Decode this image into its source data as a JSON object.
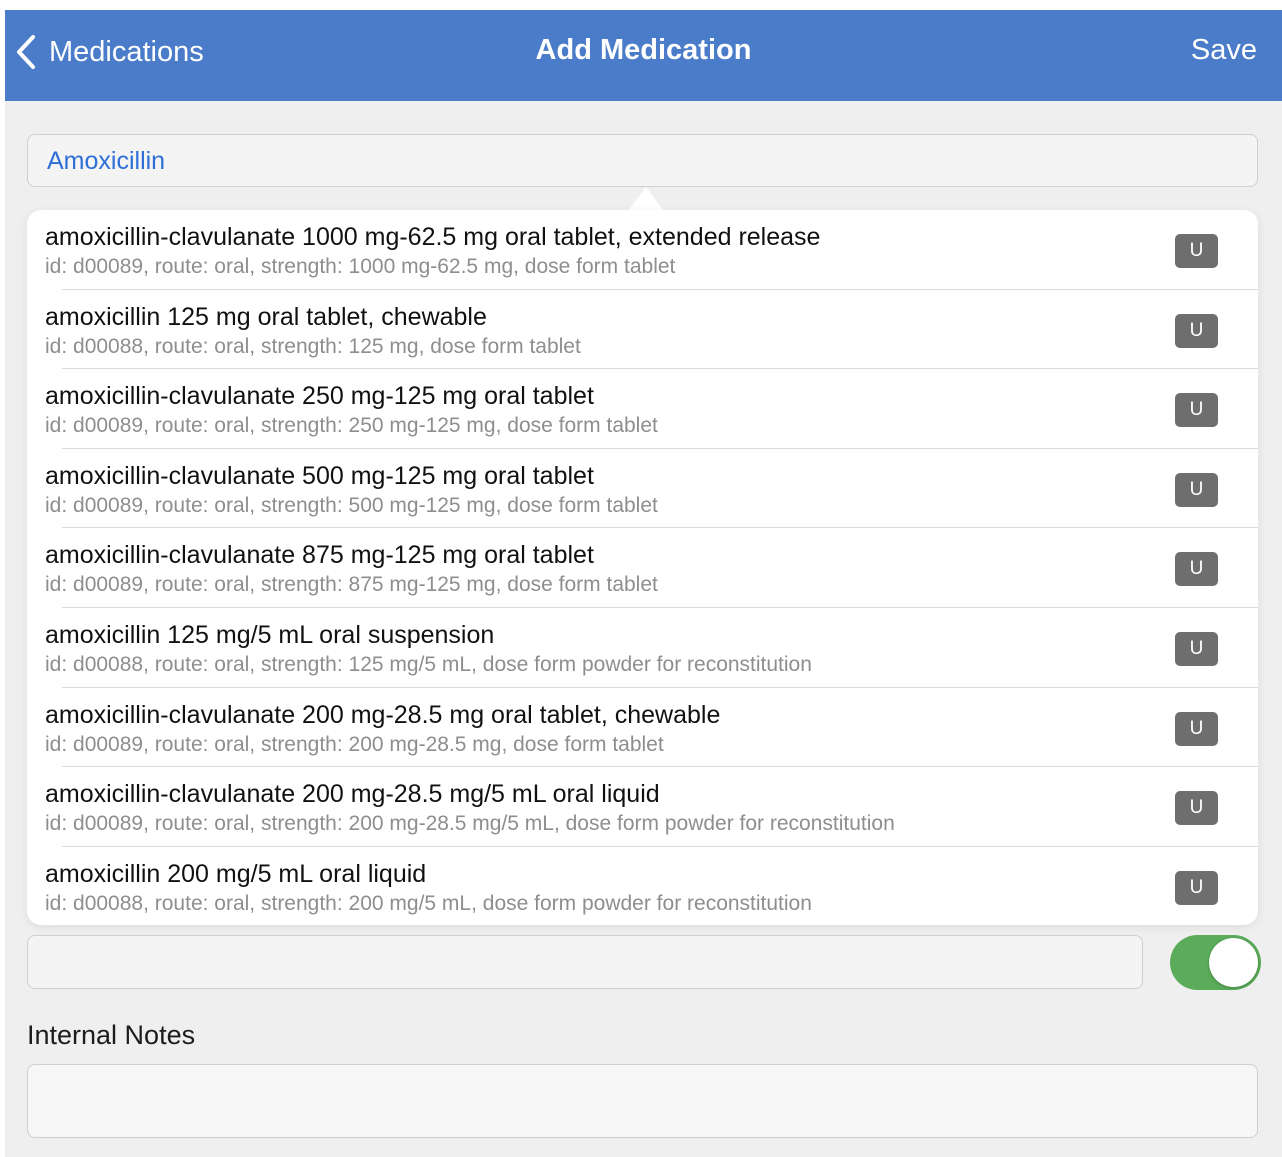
{
  "navbar": {
    "back_label": "Medications",
    "title": "Add Medication",
    "save_label": "Save"
  },
  "search": {
    "value": "Amoxicillin"
  },
  "results": [
    {
      "title": "amoxicillin-clavulanate 1000 mg-62.5 mg oral tablet, extended release",
      "subtitle": "id: d00089, route: oral, strength: 1000 mg-62.5 mg, dose form tablet",
      "badge": "U"
    },
    {
      "title": "amoxicillin 125 mg oral tablet, chewable",
      "subtitle": "id: d00088, route: oral, strength: 125 mg, dose form tablet",
      "badge": "U"
    },
    {
      "title": "amoxicillin-clavulanate 250 mg-125 mg oral tablet",
      "subtitle": "id: d00089, route: oral, strength: 250 mg-125 mg, dose form tablet",
      "badge": "U"
    },
    {
      "title": "amoxicillin-clavulanate 500 mg-125 mg oral tablet",
      "subtitle": "id: d00089, route: oral, strength: 500 mg-125 mg, dose form tablet",
      "badge": "U"
    },
    {
      "title": "amoxicillin-clavulanate 875 mg-125 mg oral tablet",
      "subtitle": "id: d00089, route: oral, strength: 875 mg-125 mg, dose form tablet",
      "badge": "U"
    },
    {
      "title": "amoxicillin 125 mg/5 mL oral suspension",
      "subtitle": "id: d00088, route: oral, strength: 125 mg/5 mL, dose form powder for reconstitution",
      "badge": "U"
    },
    {
      "title": "amoxicillin-clavulanate 200 mg-28.5 mg oral tablet, chewable",
      "subtitle": "id: d00089, route: oral, strength: 200 mg-28.5 mg, dose form tablet",
      "badge": "U"
    },
    {
      "title": "amoxicillin-clavulanate 200 mg-28.5 mg/5 mL oral liquid",
      "subtitle": "id: d00089, route: oral, strength: 200 mg-28.5 mg/5 mL, dose form powder for reconstitution",
      "badge": "U"
    },
    {
      "title": "amoxicillin 200 mg/5 mL oral liquid",
      "subtitle": "id: d00088, route: oral, strength: 200 mg/5 mL, dose form powder for reconstitution",
      "badge": "U"
    }
  ],
  "toggle": {
    "on": true,
    "color": "#5aac5a"
  },
  "internal_notes": {
    "label": "Internal Notes"
  },
  "colors": {
    "navbar": "#4a7cc9",
    "search_text": "#2e6fd6",
    "badge": "#6e6e6e"
  },
  "icons": {
    "back": "chevron-left-icon"
  }
}
